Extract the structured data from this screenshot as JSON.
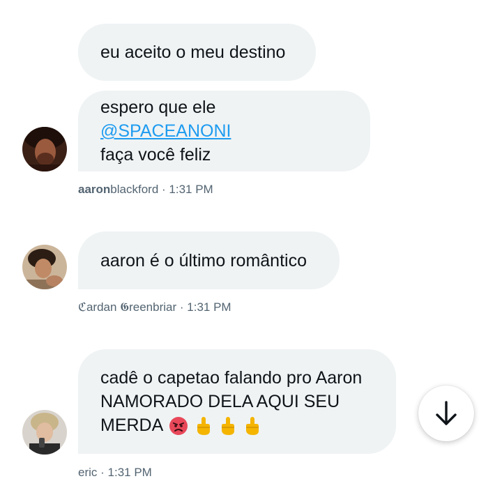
{
  "messages": [
    {
      "bubbles": [
        {
          "text": "eu aceito o meu destino"
        },
        {
          "line1_prefix": "espero que ele ",
          "mention": "@SPACEANONI",
          "line2": "faça você feliz"
        }
      ],
      "avatar_icon": "avatar-aaron",
      "author_bold": "aaron",
      "author_rest": "blackford",
      "separator": " · ",
      "time": "1:31 PM"
    },
    {
      "bubbles": [
        {
          "text": "aaron é o último romântico"
        }
      ],
      "avatar_icon": "avatar-cardan",
      "author": "ℭardan 𝕲reenbriar",
      "separator": " · ",
      "time": "1:31 PM"
    },
    {
      "bubbles": [
        {
          "line1": "cadê o capetao falando pro Aaron",
          "line2": "NAMORADO DELA AQUI SEU",
          "line3": "MERDA"
        }
      ],
      "emojis": [
        "angry-face-emoji",
        "middle-finger-emoji",
        "middle-finger-emoji",
        "middle-finger-emoji"
      ],
      "avatar_icon": "avatar-eric",
      "author": "eric",
      "separator": " · ",
      "time": "1:31 PM"
    }
  ],
  "scroll_button": {
    "icon": "arrow-down-icon"
  },
  "colors": {
    "bubble": "#eff3f4",
    "text": "#0f1419",
    "meta": "#536471",
    "mention": "#1d9bf0"
  }
}
